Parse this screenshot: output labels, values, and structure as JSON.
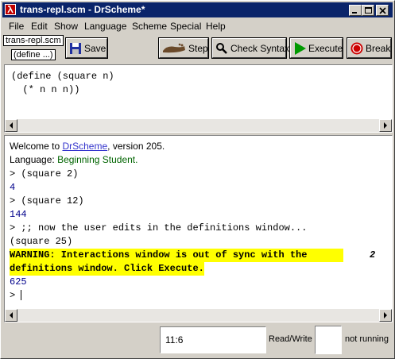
{
  "window": {
    "title": "trans-repl.scm - DrScheme*"
  },
  "menubar": {
    "items": [
      "File",
      "Edit",
      "Show",
      "Language",
      "Scheme",
      "Special",
      "Help"
    ]
  },
  "toolbar": {
    "filename_label": "trans-repl.scm",
    "define_label": "(define ...)",
    "save_label": "Save",
    "step_label": "Step",
    "check_syntax_label": "Check Syntax",
    "execute_label": "Execute",
    "break_label": "Break"
  },
  "definitions": {
    "lines": [
      "(define (square n)",
      "  (* n n n))"
    ]
  },
  "interactions": {
    "welcome_prefix": "Welcome to ",
    "welcome_link": "DrScheme",
    "welcome_suffix": ", version 205.",
    "language_prefix": "Language: ",
    "language_value": "Beginning Student",
    "language_suffix": ".",
    "prompt1": "> (square 2)",
    "result1": "4",
    "prompt2": "> (square 12)",
    "result2": "144",
    "prompt3": "> ;; now the user edits in the definitions window...",
    "input4": "(square 25)",
    "warning_line1": "WARNING: Interactions window is out of sync with the",
    "warning_line2": "definitions window. Click Execute.",
    "result4": "625",
    "prompt_final": "> "
  },
  "statusbar": {
    "position": "11:6",
    "mode": "Read/Write",
    "run_status": "not running"
  },
  "colors": {
    "title_bg": "#0a246a",
    "warning_bg": "#ffff00",
    "link": "#3333cc",
    "result": "#00008b",
    "language": "#006400"
  }
}
